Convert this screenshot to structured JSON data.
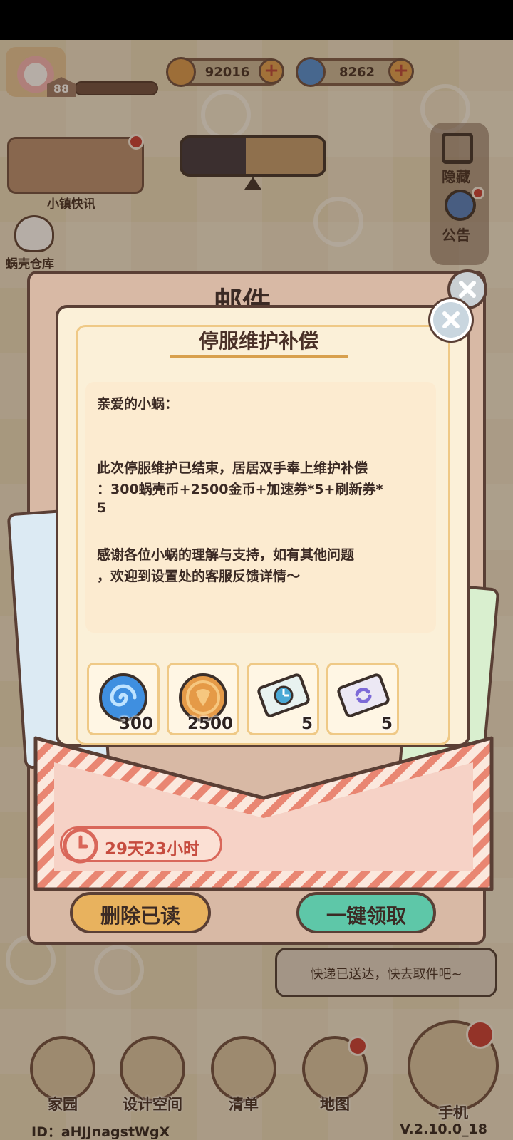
{
  "hud": {
    "level": "88",
    "snail_coins": "92016",
    "shell_coins": "8262",
    "plus_label": "+"
  },
  "left_menu": {
    "news_label": "小镇快讯",
    "warehouse_label": "蜗壳仓库"
  },
  "right_menu": {
    "hide_label": "隐藏",
    "notice_label": "公告"
  },
  "mailbox": {
    "title": "邮件",
    "delete_read_label": "删除已读",
    "claim_all_label": "一键领取"
  },
  "letter": {
    "title": "停服维护补偿",
    "lines": [
      "亲爱的小蜗：",
      "此次停服维护已结束，居居双手奉上维护补偿",
      "：300蜗壳币+2500金币+加速券*5+刷新券*",
      "5",
      "感谢各位小蜗的理解与支持，如有其他问题",
      "，欢迎到设置处的客服反馈详情～"
    ],
    "rewards": [
      {
        "icon": "shell-coin-icon",
        "qty": "300"
      },
      {
        "icon": "gold-coin-icon",
        "qty": "2500"
      },
      {
        "icon": "speedup-ticket-icon",
        "qty": "5"
      },
      {
        "icon": "refresh-ticket-icon",
        "qty": "5"
      }
    ],
    "expiry": "29天23小时"
  },
  "bubble": {
    "text": "快递已送达，快去取件吧~"
  },
  "nav": {
    "items": [
      "家园",
      "设计空间",
      "清单",
      "地图",
      "手机"
    ]
  },
  "footer": {
    "id": "ID：aHJJnagstWgX",
    "version": "V.2.10.0_18"
  },
  "colors": {
    "accent_red": "#c83a35",
    "envelope_pink": "#f6d2c6",
    "paper": "#fbf0d8",
    "outline": "#5a3f35"
  }
}
